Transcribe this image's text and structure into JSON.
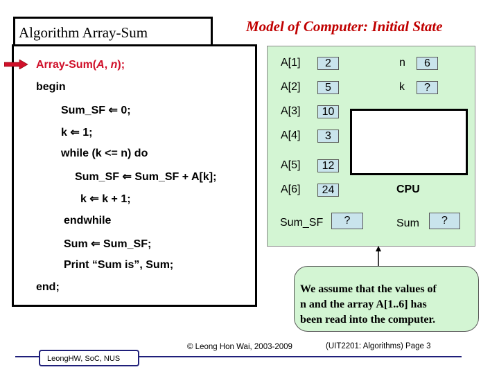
{
  "slide": {
    "algorithm_title": "Algorithm Array-Sum",
    "model_title": "Model of Computer: Initial State",
    "code": [
      "Array-Sum(A, n);",
      "begin",
      "Sum_SF ⇐ 0;",
      "k ⇐ 1;",
      "while (k <= n) do",
      "Sum_SF ⇐ Sum_SF + A[k];",
      "k ⇐ k + 1;",
      "endwhile",
      "Sum ⇐ Sum_SF;",
      "Print “Sum is”, Sum;",
      "end;"
    ],
    "current_line_color": "#d0102a",
    "memory": {
      "array": [
        {
          "label": "A[1]",
          "value": "2"
        },
        {
          "label": "A[2]",
          "value": "5"
        },
        {
          "label": "A[3]",
          "value": "10"
        },
        {
          "label": "A[4]",
          "value": "3"
        },
        {
          "label": "A[5]",
          "value": "12"
        },
        {
          "label": "A[6]",
          "value": "24"
        }
      ],
      "n": {
        "label": "n",
        "value": "6"
      },
      "k": {
        "label": "k",
        "value": "?"
      },
      "sum_sf": {
        "label": "Sum_SF",
        "value": "?"
      },
      "sum": {
        "label": "Sum",
        "value": "?"
      },
      "cpu_label": "CPU"
    },
    "callout": [
      "We assume that the values of",
      "n and the array A[1..6] has",
      "been read into the computer."
    ],
    "footer": {
      "author": "LeongHW, SoC, NUS",
      "copyright": "© Leong Hon Wai, 2003-2009",
      "page": "(UIT2201: Algorithms) Page 3"
    }
  }
}
